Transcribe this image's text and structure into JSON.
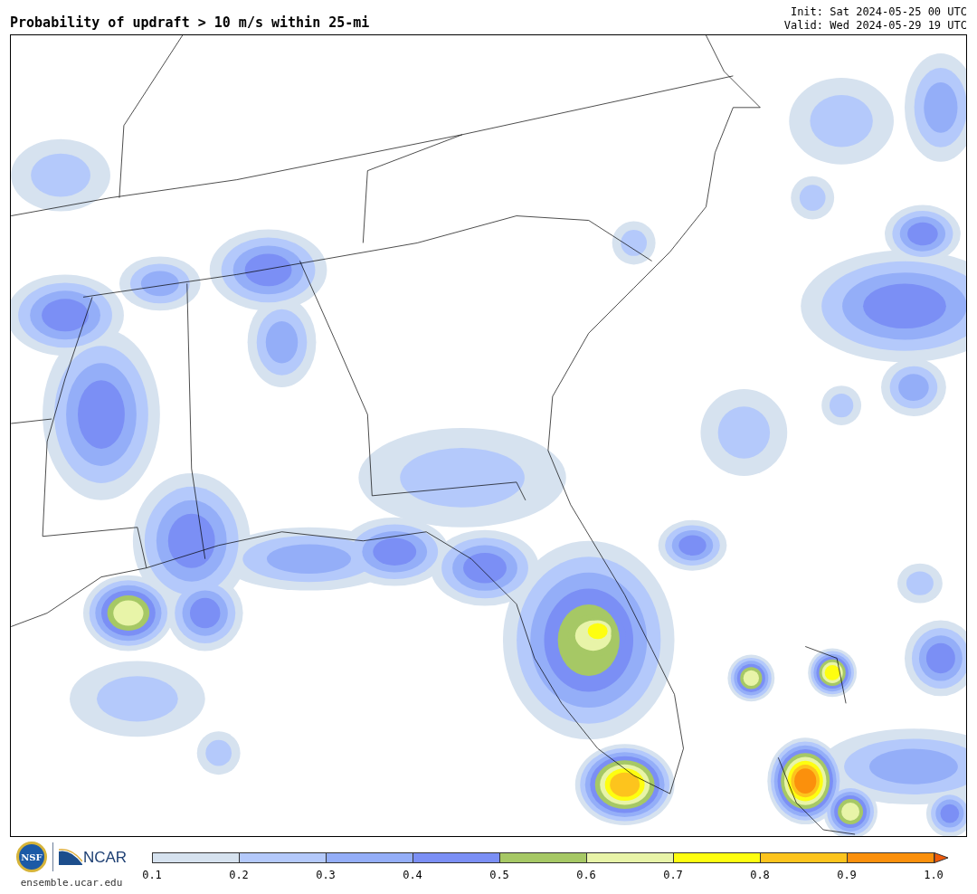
{
  "title": "Probability of updraft > 10 m/s within 25-mi",
  "init": "Init: Sat 2024-05-25 00 UTC",
  "valid": "Valid: Wed 2024-05-29 19 UTC",
  "logos": {
    "nsf": "NSF",
    "ncar": "NCAR"
  },
  "site": "ensemble.ucar.edu",
  "colorbar": {
    "bins": [
      {
        "color": "#d6e2ef"
      },
      {
        "color": "#b4c9fb"
      },
      {
        "color": "#94aef8"
      },
      {
        "color": "#7b8ff5"
      },
      {
        "color": "#a6c865"
      },
      {
        "color": "#e8f4a8"
      },
      {
        "color": "#fefe10"
      },
      {
        "color": "#fdc41d"
      },
      {
        "color": "#fb900c"
      }
    ],
    "ticks": [
      "0.1",
      "0.2",
      "0.3",
      "0.4",
      "0.5",
      "0.6",
      "0.7",
      "0.8",
      "0.9",
      "1.0"
    ]
  }
}
